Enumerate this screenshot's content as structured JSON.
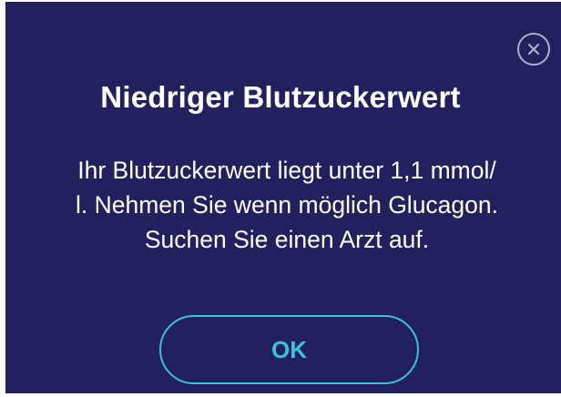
{
  "dialog": {
    "title": "Niedriger Blutzuckerwert",
    "message_lines": [
      "Ihr Blutzuckerwert liegt unter 1,1 mmol/",
      "l. Nehmen Sie wenn möglich Glucagon.",
      "Suchen Sie einen Arzt auf."
    ],
    "ok_label": "OK",
    "close_icon": "close-icon"
  },
  "colors": {
    "background": "#22205f",
    "text": "#ffffff",
    "accent": "#39c3dc"
  }
}
